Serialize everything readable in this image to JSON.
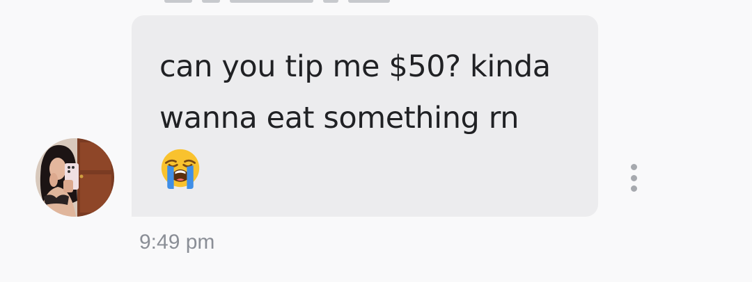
{
  "message": {
    "text": "can you tip me $50? kinda wanna eat something rn",
    "emoji": "😭",
    "emoji_name": "loudly-crying-face",
    "timestamp": "9:49 pm",
    "bubble_color": "#ececee",
    "text_color": "#202124"
  },
  "actions": {
    "more_icon": "more-vertical-icon"
  },
  "colors": {
    "background": "#f9f9fa",
    "timestamp": "#8a8e96",
    "menu_dots": "#a6a9ae"
  }
}
